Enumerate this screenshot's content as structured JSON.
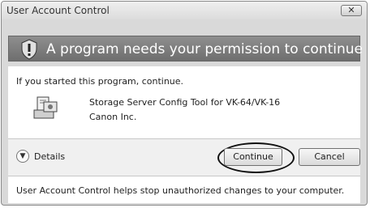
{
  "window": {
    "title": "User Account Control",
    "close_icon": "close-icon"
  },
  "banner": {
    "icon": "shield-icon",
    "message": "A program needs your permission to continue"
  },
  "content": {
    "intro": "If you started this program, continue.",
    "program_icon": "program-icon",
    "program_name": "Storage Server Config Tool for VK-64/VK-16",
    "publisher": "Canon Inc."
  },
  "controls": {
    "details_icon": "chevron-down-icon",
    "details_label": "Details",
    "continue_label": "Continue",
    "cancel_label": "Cancel"
  },
  "footer": {
    "text": "User Account Control helps stop unauthorized changes to your computer."
  },
  "colors": {
    "banner_bg": "#7d7d7d",
    "banner_text": "#ffffff",
    "dialog_bg": "#d9d9d9"
  }
}
